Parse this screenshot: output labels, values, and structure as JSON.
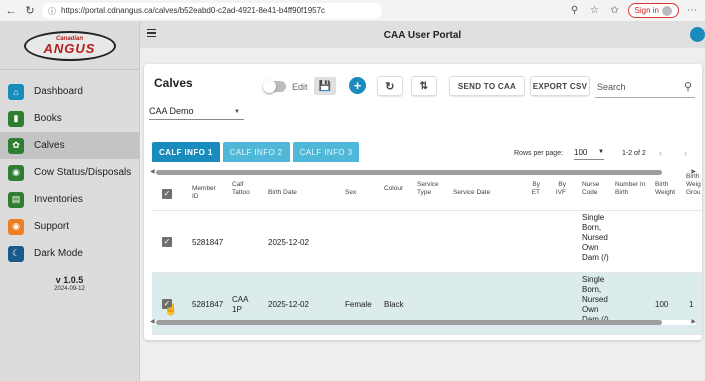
{
  "browser": {
    "url": "https://portal.cdnangus.ca/calves/b52eabd0-c2ad-4921-8e41-b4ff90f1957c",
    "sign_in_label": "Sign in"
  },
  "logo": {
    "line1": "Canadian",
    "line2": "ANGUS"
  },
  "sidebar": {
    "items": [
      {
        "label": "Dashboard",
        "icon": "home-icon",
        "color": "#1a8bbd"
      },
      {
        "label": "Books",
        "icon": "book-icon",
        "color": "#2e7d32"
      },
      {
        "label": "Calves",
        "icon": "calf-icon",
        "color": "#2e7d32"
      },
      {
        "label": "Cow Status/Disposals",
        "icon": "cow-icon",
        "color": "#2e7d32"
      },
      {
        "label": "Inventories",
        "icon": "inventory-icon",
        "color": "#2e7d32"
      },
      {
        "label": "Support",
        "icon": "support-icon",
        "color": "#ef7d22"
      },
      {
        "label": "Dark Mode",
        "icon": "moon-icon",
        "color": "#1a5a8a"
      }
    ],
    "version": "v 1.0.5",
    "version_date": "2024-09-12"
  },
  "appbar": {
    "title": "CAA User Portal"
  },
  "card": {
    "title": "Calves",
    "edit_label": "Edit",
    "refresh_icon": "refresh-icon",
    "sort_icon": "sort-icon",
    "send_label": "SEND TO CAA",
    "export_label": "EXPORT CSV",
    "search_placeholder": "Search",
    "herd_value": "CAA Demo"
  },
  "tabs": [
    {
      "label": "CALF INFO 1"
    },
    {
      "label": "CALF INFO 2"
    },
    {
      "label": "CALF INFO 3"
    }
  ],
  "pagination": {
    "rows_per_page_label": "Rows per page:",
    "rows_per_page": "100",
    "range": "1-2 of 2"
  },
  "table": {
    "headers": {
      "member_id": "Member ID",
      "calf_tattoo": "Calf Tattoo",
      "birth_date": "Birth Date",
      "sex": "Sex",
      "colour": "Colour",
      "service_type": "Service Type",
      "service_date": "Service Date",
      "by_et": "By ET",
      "by_ivf": "By IVF",
      "nurse_code": "Nurse Code",
      "number_in_birth": "Number In Birth",
      "birth_weight": "Birth Weight",
      "birth_weight_group": "Birth Weig Grou"
    },
    "rows": [
      {
        "member_id": "5281847",
        "calf_tattoo": "",
        "birth_date": "2025-12-02",
        "sex": "",
        "colour": "",
        "nurse_code": "Single Born, Nursed Own Dam (/)",
        "birth_weight": "",
        "birth_weight_group": ""
      },
      {
        "member_id": "5281847",
        "calf_tattoo": "CAA 1P",
        "birth_date": "2025-12-02",
        "sex": "Female",
        "colour": "Black",
        "nurse_code": "Single Born, Nursed Own Dam (/)",
        "birth_weight": "100",
        "birth_weight_group": "1"
      }
    ]
  },
  "colors": {
    "accent": "#1a8bbd",
    "tab": "#29a3c9",
    "selected_row": "#dcebec"
  }
}
